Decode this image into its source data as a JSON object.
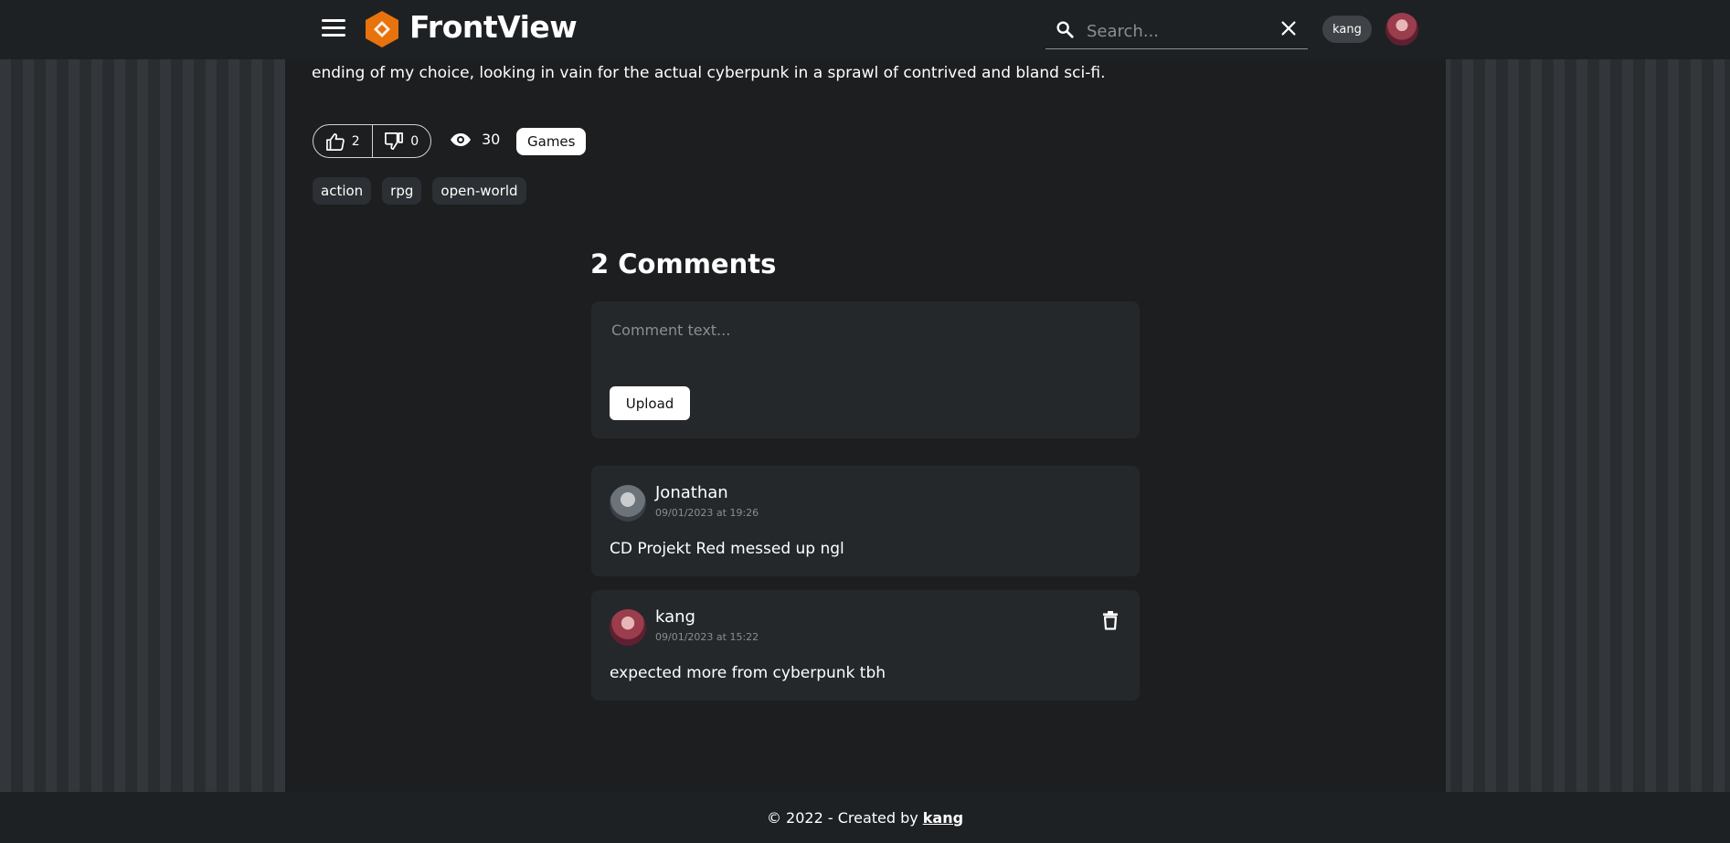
{
  "header": {
    "logo_text": "FrontView",
    "search_placeholder": "Search...",
    "username_chip": "kang",
    "accent_color": "#e8720c"
  },
  "post": {
    "text_fragment": "ending of my choice, looking in vain for the actual cyberpunk in a sprawl of contrived and bland sci-fi.",
    "likes": "2",
    "dislikes": "0",
    "views": "30",
    "category": "Games",
    "tags": [
      "action",
      "rpg",
      "open-world"
    ]
  },
  "comments": {
    "title": "2 Comments",
    "form": {
      "placeholder": "Comment text...",
      "upload_label": "Upload"
    },
    "items": [
      {
        "author": "Jonathan",
        "date": "09/01/2023 at 19:26",
        "text": "CD Projekt Red messed up ngl"
      },
      {
        "author": "kang",
        "date": "09/01/2023 at 15:22",
        "text": "expected more from cyberpunk tbh"
      }
    ]
  },
  "footer": {
    "text": "© 2022 - Created by",
    "link": "kang"
  },
  "icons": [
    "menu-icon",
    "logo-icon",
    "search-icon",
    "close-icon",
    "thumb-up-icon",
    "thumb-down-icon",
    "eye-icon",
    "delete-icon"
  ]
}
